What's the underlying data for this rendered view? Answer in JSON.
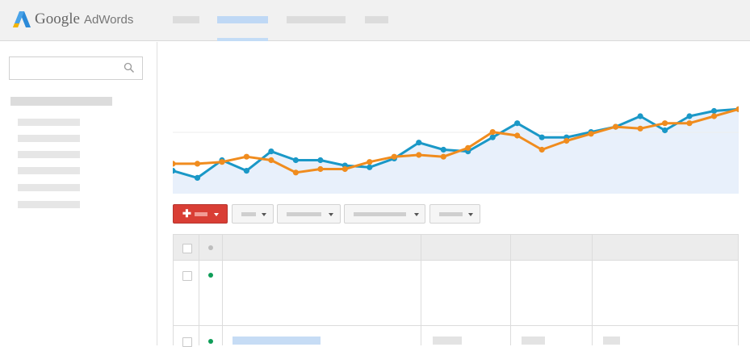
{
  "app": {
    "logo_google": "Google",
    "logo_adwords": "AdWords"
  },
  "colors": {
    "topbar": "#f1f1f1",
    "accent_blue": "#1a98c7",
    "accent_orange": "#f08c1e",
    "add_button_red": "#d93e35",
    "status_enabled_green": "#0f9d58"
  },
  "icons": {
    "search": "search-icon",
    "add": "plus-icon",
    "dropdown": "chevron-down-icon"
  },
  "chart_data": {
    "type": "area",
    "series": [
      {
        "values": [
          0.13,
          0.09,
          0.19,
          0.13,
          0.24,
          0.19,
          0.19,
          0.16,
          0.15,
          0.2,
          0.29,
          0.25,
          0.24,
          0.32,
          0.4,
          0.32,
          0.32,
          0.35,
          0.38,
          0.44,
          0.36,
          0.44,
          0.47,
          0.48
        ]
      },
      {
        "values": [
          0.17,
          0.17,
          0.18,
          0.21,
          0.19,
          0.12,
          0.14,
          0.14,
          0.18,
          0.21,
          0.22,
          0.21,
          0.26,
          0.35,
          0.33,
          0.25,
          0.3,
          0.34,
          0.38,
          0.37,
          0.4,
          0.4,
          0.44,
          0.48
        ]
      }
    ],
    "grid": false
  }
}
